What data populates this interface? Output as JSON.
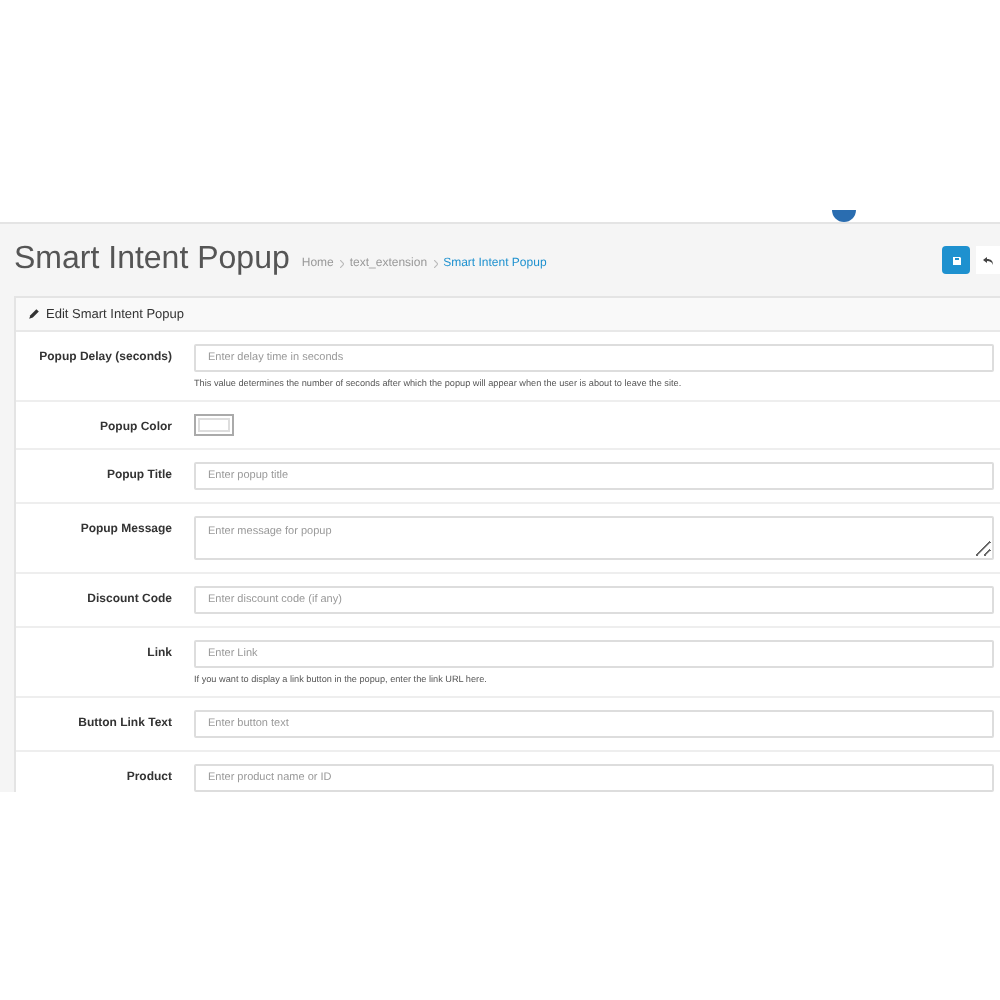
{
  "page": {
    "title": "Smart Intent Popup",
    "breadcrumb": [
      {
        "label": "Home",
        "selected": false
      },
      {
        "label": "text_extension",
        "selected": false
      },
      {
        "label": "Smart Intent Popup",
        "selected": true
      }
    ]
  },
  "panel": {
    "heading": "Edit Smart Intent Popup"
  },
  "fields": [
    {
      "kind": "text",
      "label": "Popup Delay (seconds)",
      "placeholder": "Enter delay time in seconds",
      "help": "This value determines the number of seconds after which the popup will appear when the user is about to leave the site."
    },
    {
      "kind": "color",
      "label": "Popup Color"
    },
    {
      "kind": "text",
      "label": "Popup Title",
      "placeholder": "Enter popup title"
    },
    {
      "kind": "textarea",
      "label": "Popup Message",
      "placeholder": "Enter message for popup"
    },
    {
      "kind": "text",
      "label": "Discount Code",
      "placeholder": "Enter discount code (if any)"
    },
    {
      "kind": "text",
      "label": "Link",
      "placeholder": "Enter Link",
      "help": "If you want to display a link button in the popup, enter the link URL here."
    },
    {
      "kind": "text",
      "label": "Button Link Text",
      "placeholder": "Enter button text"
    },
    {
      "kind": "text",
      "label": "Product",
      "placeholder": "Enter product name or ID"
    }
  ]
}
